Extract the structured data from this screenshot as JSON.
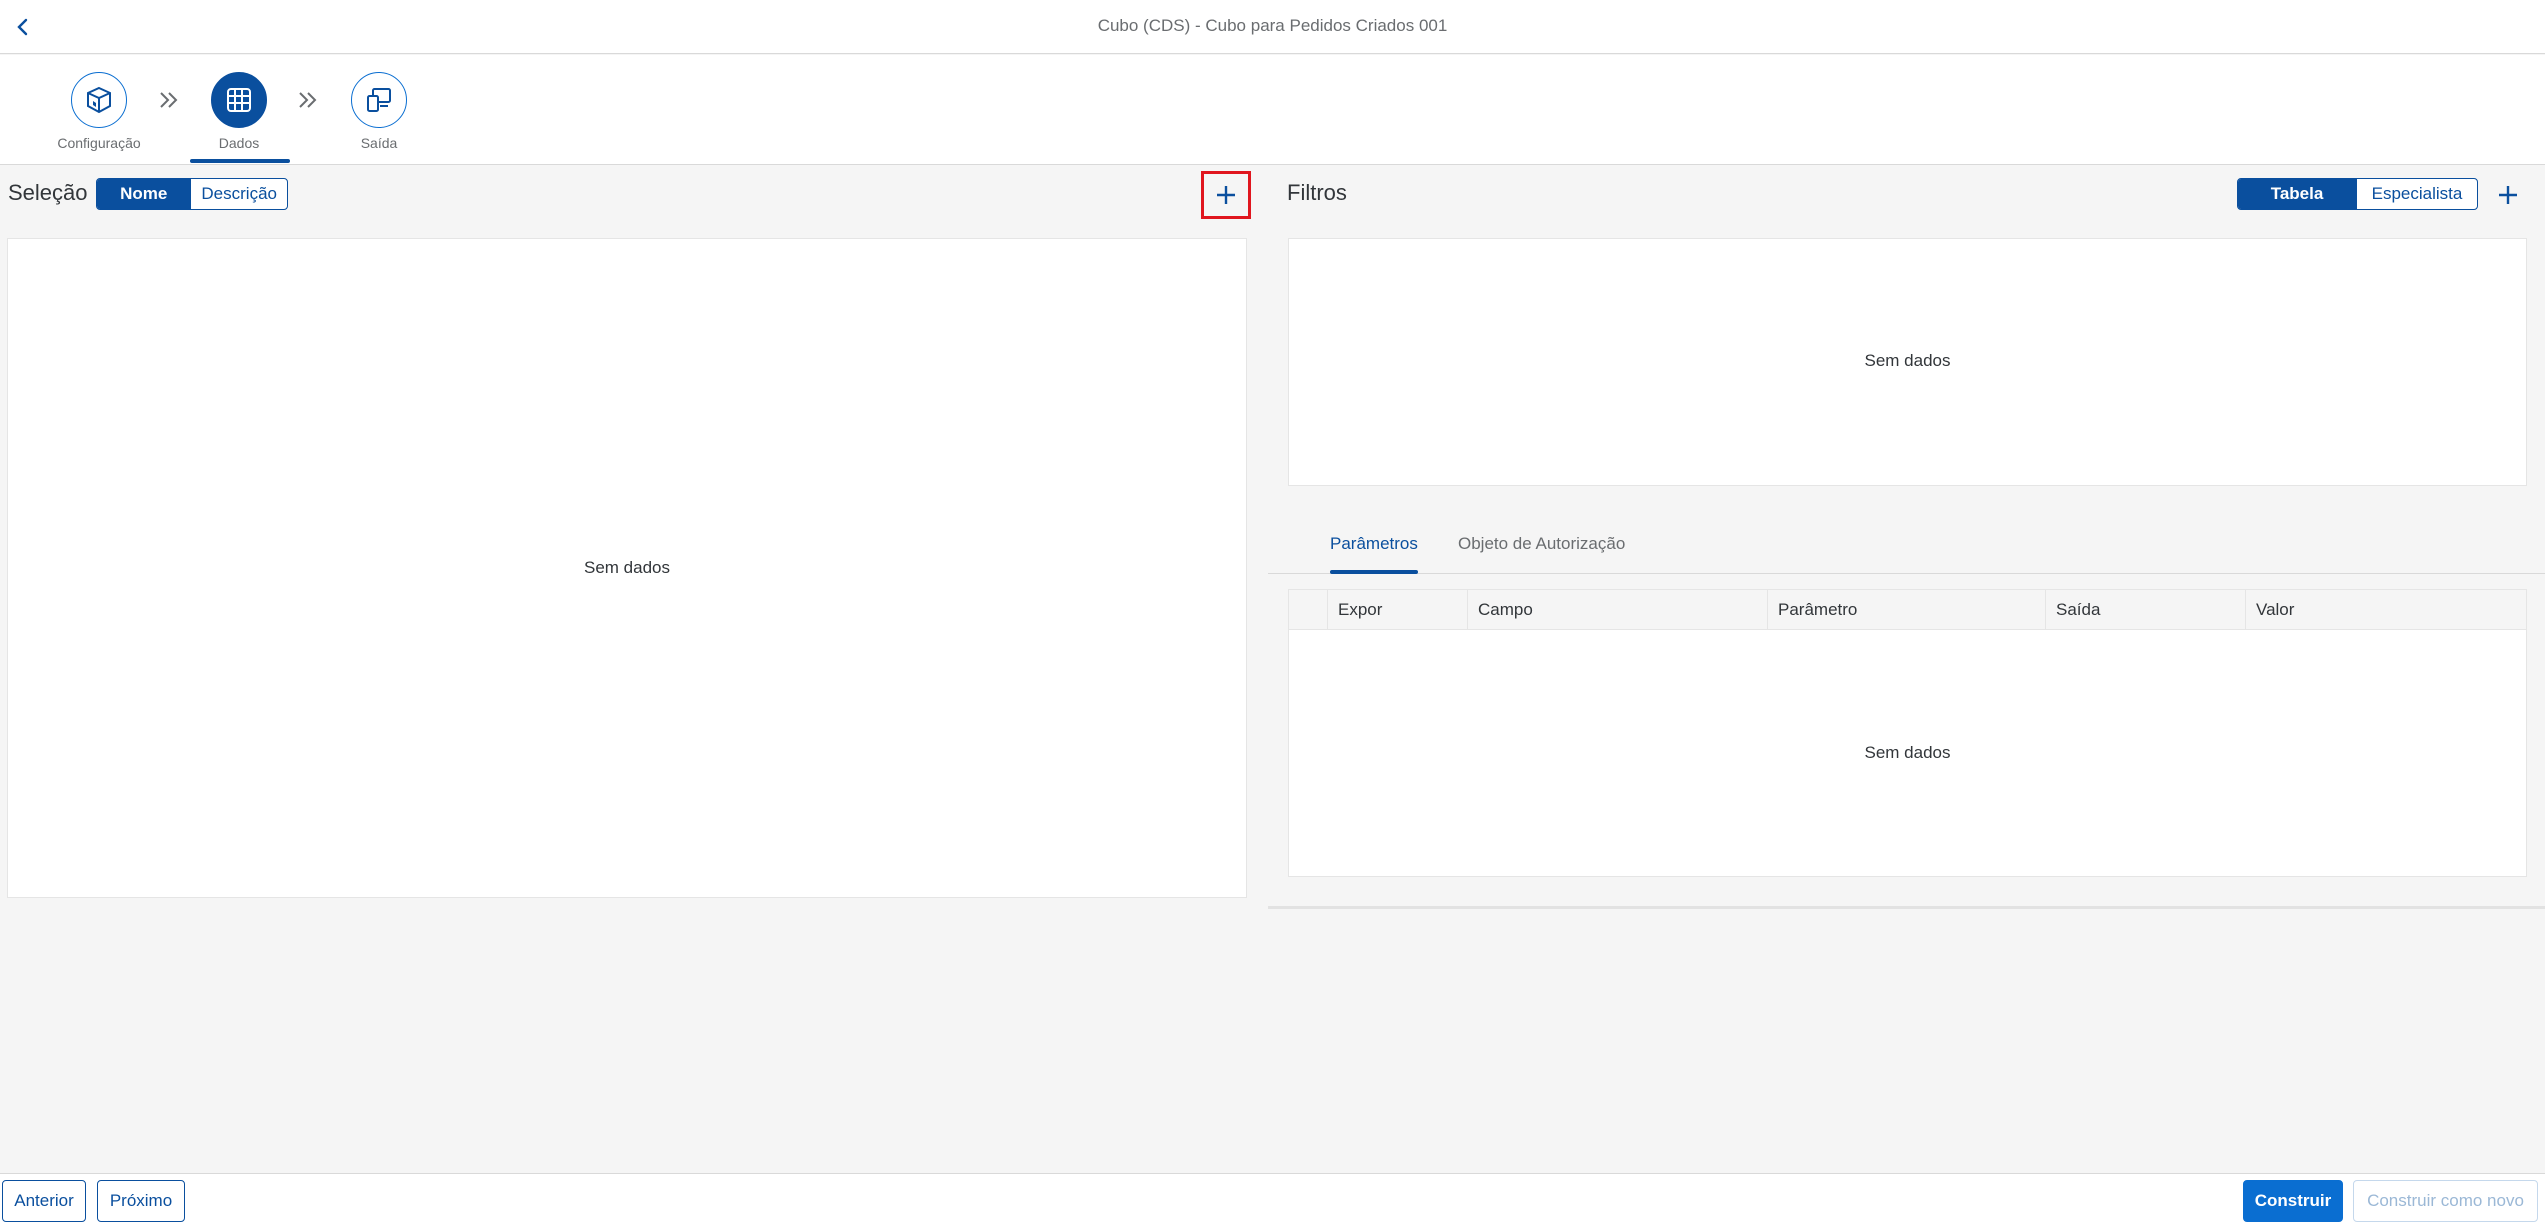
{
  "header": {
    "title": "Cubo (CDS) - Cubo para Pedidos Criados 001",
    "back_icon": "chevron-left-icon"
  },
  "wizard": {
    "steps": [
      {
        "label": "Configuração",
        "icon": "cube-icon",
        "active": false
      },
      {
        "label": "Dados",
        "icon": "grid-icon",
        "active": true
      },
      {
        "label": "Saída",
        "icon": "devices-icon",
        "active": false
      }
    ],
    "separator_icon": "double-chevron-right-icon"
  },
  "selection": {
    "title": "Seleção",
    "toggle": {
      "name": "Nome",
      "description": "Descrição",
      "selected": "Nome"
    },
    "add_icon": "plus-icon",
    "empty_text": "Sem dados"
  },
  "filters": {
    "title": "Filtros",
    "toggle": {
      "table": "Tabela",
      "expert": "Especialista",
      "selected": "Tabela"
    },
    "add_icon": "plus-icon",
    "empty_text": "Sem dados"
  },
  "tabs": [
    {
      "label": "Parâmetros",
      "active": true
    },
    {
      "label": "Objeto de Autorização",
      "active": false
    }
  ],
  "params_table": {
    "columns": [
      "Expor",
      "Campo",
      "Parâmetro",
      "Saída",
      "Valor"
    ],
    "empty_text": "Sem dados"
  },
  "footer": {
    "previous": "Anterior",
    "next": "Próximo",
    "build": "Construir",
    "build_new": "Construir como novo"
  },
  "colors": {
    "brand": "#0a4f9e",
    "primary": "#0a6ed1",
    "highlight": "#e0161e"
  }
}
